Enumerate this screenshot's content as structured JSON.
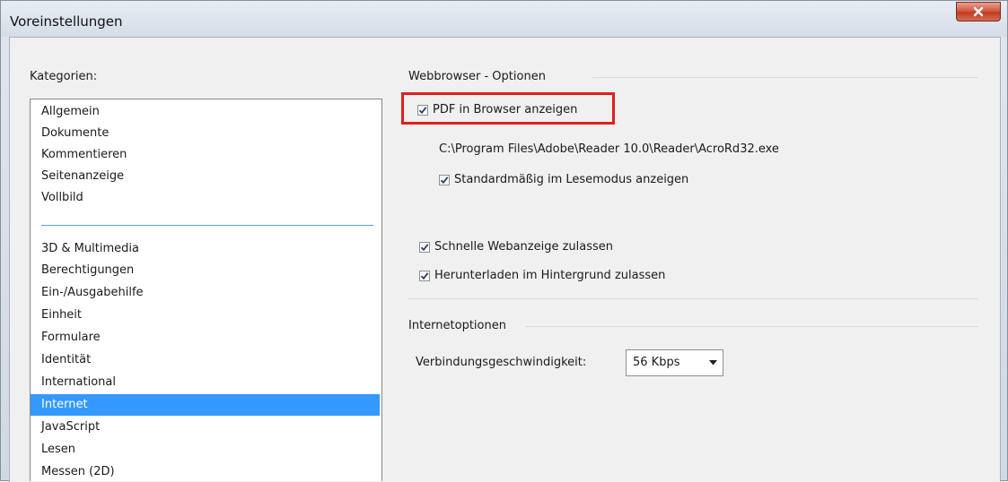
{
  "window": {
    "title": "Voreinstellungen",
    "close_label": "X"
  },
  "categories": {
    "label": "Kategorien:",
    "group1": [
      "Allgemein",
      "Dokumente",
      "Kommentieren",
      "Seitenanzeige",
      "Vollbild"
    ],
    "group2": [
      "3D & Multimedia",
      "Berechtigungen",
      "Ein-/Ausgabehilfe",
      "Einheit",
      "Formulare",
      "Identität",
      "International",
      "Internet",
      "JavaScript",
      "Lesen",
      "Messen (2D)"
    ],
    "selected": "Internet"
  },
  "webbrowser": {
    "title": "Webbrowser - Optionen",
    "pdf_in_browser": {
      "label": "PDF in Browser anzeigen",
      "checked": true
    },
    "reader_path": "C:\\Program Files\\Adobe\\Reader 10.0\\Reader\\AcroRd32.exe",
    "read_mode": {
      "label": "Standardmäßig im Lesemodus anzeigen",
      "checked": true
    },
    "fast_web_view": {
      "label": "Schnelle Webanzeige zulassen",
      "checked": true
    },
    "background_download": {
      "label": "Herunterladen im Hintergrund zulassen",
      "checked": true
    }
  },
  "internet": {
    "title": "Internetoptionen",
    "speed_label": "Verbindungsgeschwindigkeit:",
    "speed_value": "56 Kbps"
  },
  "colors": {
    "selection": "#3399ff",
    "highlight_box": "#e02020"
  }
}
